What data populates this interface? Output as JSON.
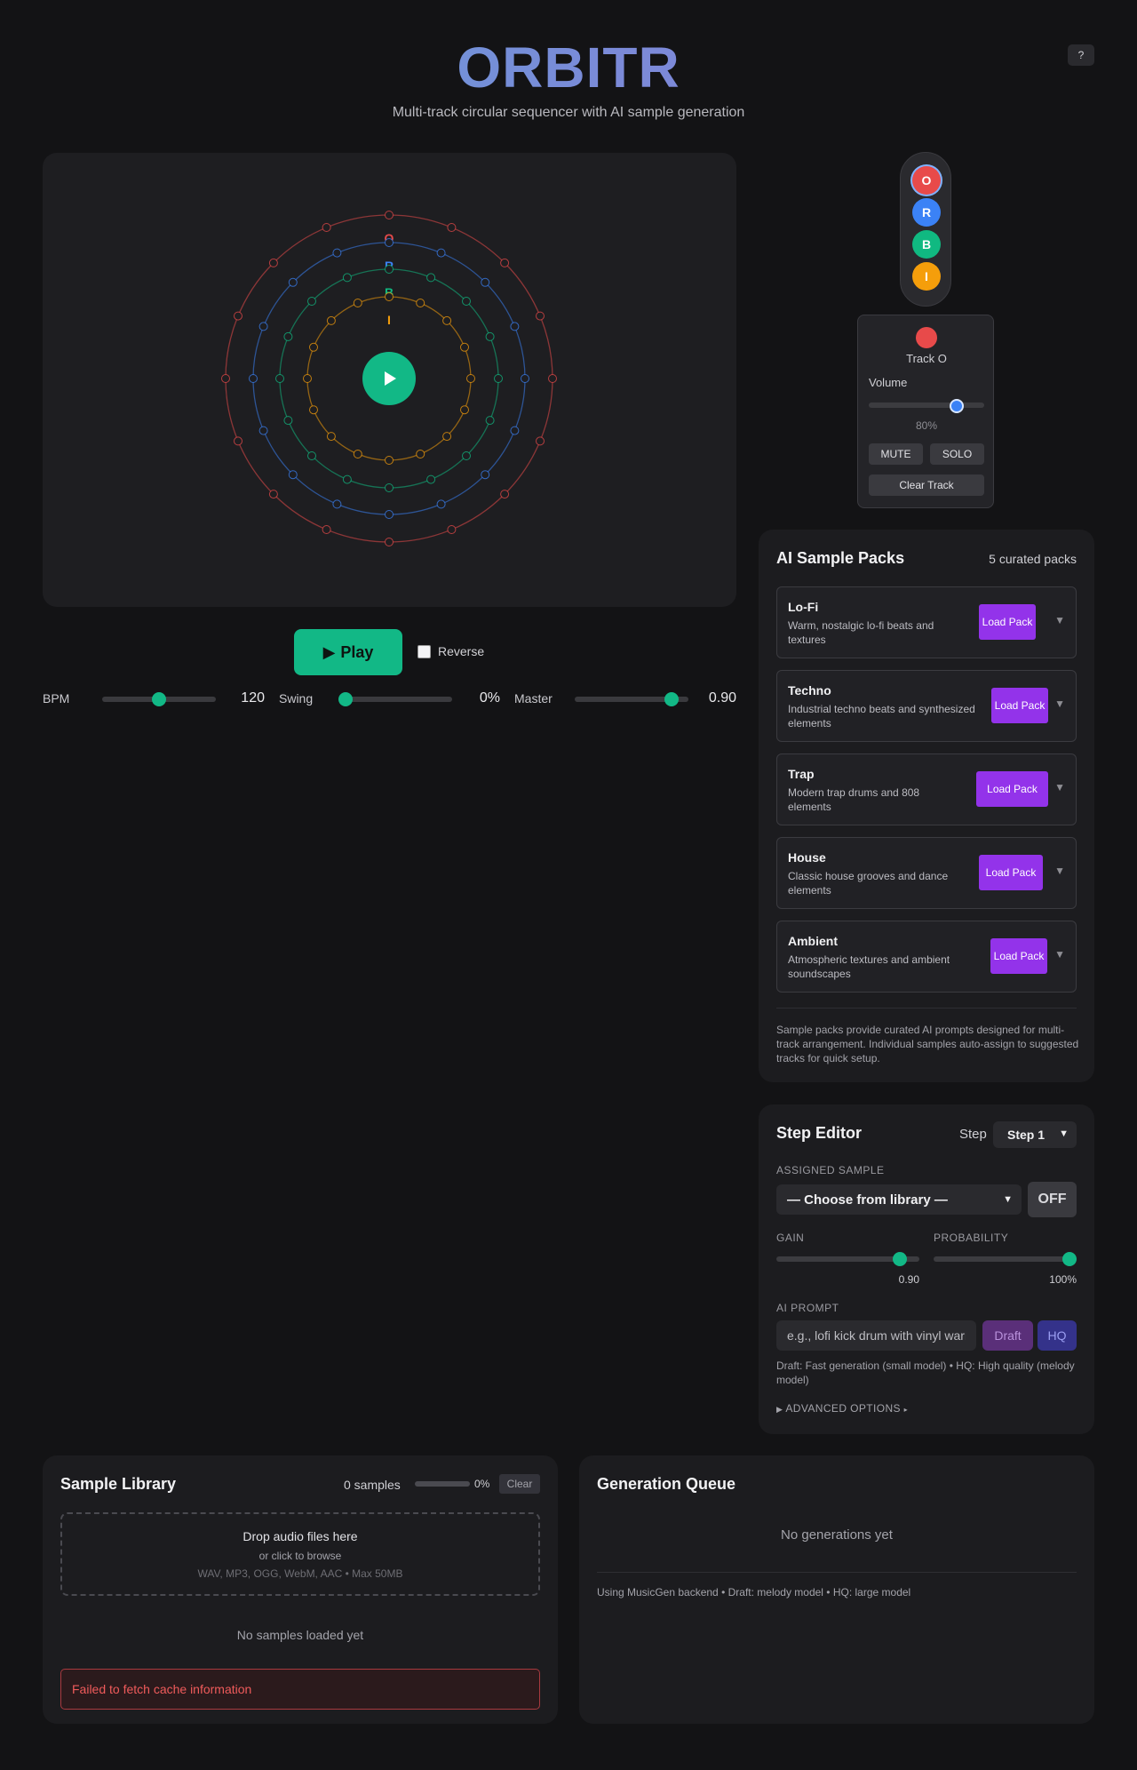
{
  "header": {
    "title": "ORBITR",
    "subtitle": "Multi-track circular sequencer with AI sample generation",
    "help_label": "?"
  },
  "sequencer": {
    "steps_per_ring": 16,
    "rings": [
      {
        "label": "O",
        "color": "#e84a4a"
      },
      {
        "label": "R",
        "color": "#3b82f6"
      },
      {
        "label": "B",
        "color": "#10b981"
      },
      {
        "label": "I",
        "color": "#f59e0b"
      }
    ],
    "center_button_color": "#12b886"
  },
  "transport": {
    "play_label": "Play",
    "reverse_label": "Reverse",
    "reverse_checked": false,
    "bpm": {
      "label": "BPM",
      "value": "120",
      "fraction": 0.5
    },
    "swing": {
      "label": "Swing",
      "value": "0%",
      "fraction": 0.0
    },
    "master": {
      "label": "Master",
      "value": "0.90",
      "fraction": 0.9
    }
  },
  "tracks": {
    "items": [
      {
        "label": "O",
        "color": "#e84a4a",
        "selected": true
      },
      {
        "label": "R",
        "color": "#3b82f6",
        "selected": false
      },
      {
        "label": "B",
        "color": "#10b981",
        "selected": false
      },
      {
        "label": "I",
        "color": "#f59e0b",
        "selected": false
      }
    ],
    "active": {
      "name": "Track O",
      "volume_label": "Volume",
      "volume_value": "80%",
      "volume_fraction": 0.8,
      "mute_label": "MUTE",
      "solo_label": "SOLO",
      "clear_label": "Clear Track"
    }
  },
  "packs": {
    "title": "AI Sample Packs",
    "count_label": "5 curated packs",
    "load_label": "Load Pack",
    "items": [
      {
        "name": "Lo-Fi",
        "description": "Warm, nostalgic lo-fi beats and textures"
      },
      {
        "name": "Techno",
        "description": "Industrial techno beats and synthesized elements"
      },
      {
        "name": "Trap",
        "description": "Modern trap drums and 808 elements"
      },
      {
        "name": "House",
        "description": "Classic house grooves and dance elements"
      },
      {
        "name": "Ambient",
        "description": "Atmospheric textures and ambient soundscapes"
      }
    ],
    "note": "Sample packs provide curated AI prompts designed for multi-track arrangement. Individual samples auto-assign to suggested tracks for quick setup."
  },
  "step_editor": {
    "title": "Step Editor",
    "step_label": "Step",
    "step_selected": "Step 1",
    "assigned_label": "ASSIGNED SAMPLE",
    "sample_selected": "— Choose from library —",
    "off_label": "OFF",
    "gain_label": "GAIN",
    "gain_value": "0.90",
    "gain_fraction": 0.9,
    "probability_label": "PROBABILITY",
    "probability_value": "100%",
    "probability_fraction": 1.0,
    "prompt_label": "AI PROMPT",
    "prompt_placeholder": "e.g., lofi kick drum with vinyl warmth",
    "draft_label": "Draft",
    "hq_label": "HQ",
    "help_text": "Draft: Fast generation (small model) • HQ: High quality (melody model)",
    "advanced_label": "ADVANCED OPTIONS"
  },
  "library": {
    "title": "Sample Library",
    "count_label": "0 samples",
    "progress_value": "0%",
    "progress_fraction": 0,
    "clear_label": "Clear",
    "drop_title": "Drop audio files here",
    "drop_subtitle": "or click to browse",
    "drop_formats": "WAV, MP3, OGG, WebM, AAC • Max 50MB",
    "empty_label": "No samples loaded yet",
    "error_message": "Failed to fetch cache information"
  },
  "queue": {
    "title": "Generation Queue",
    "empty_label": "No generations yet",
    "note": "Using MusicGen backend • Draft: melody model • HQ: large model"
  }
}
